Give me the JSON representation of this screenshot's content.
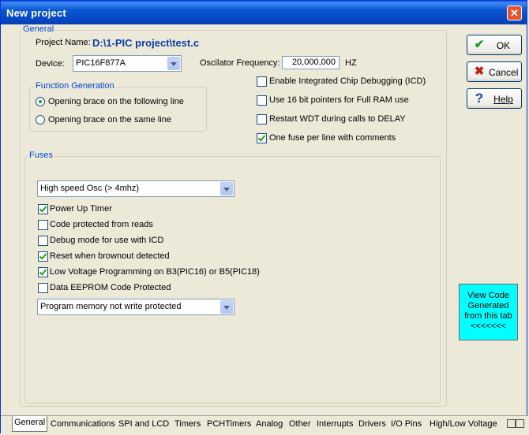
{
  "window": {
    "title": "New project"
  },
  "general": {
    "legend": "General",
    "project_name_label": "Project Name:",
    "project_name": "D:\\1-PIC project\\test.c",
    "device_label": "Device:",
    "device_value": "PIC16F877A",
    "osc_label": "Oscilator Frequency:",
    "osc_value": "20,000,000",
    "osc_unit": "HZ"
  },
  "function_generation": {
    "legend": "Function Generation",
    "options": [
      {
        "label": "Opening brace on the following line",
        "selected": true
      },
      {
        "label": "Opening brace on the same line",
        "selected": false
      }
    ]
  },
  "options": [
    {
      "label": "Enable Integrated Chip Debugging (ICD)",
      "checked": false
    },
    {
      "label": "Use 16 bit pointers for Full RAM use",
      "checked": false
    },
    {
      "label": "Restart WDT during calls to DELAY",
      "checked": false
    },
    {
      "label": "One fuse per line with comments",
      "checked": true
    }
  ],
  "fuses": {
    "legend": "Fuses",
    "oscillator_select": "High speed Osc (> 4mhz)",
    "items": [
      {
        "label": "Power Up Timer",
        "checked": true
      },
      {
        "label": "Code protected from reads",
        "checked": false
      },
      {
        "label": "Debug mode for use with ICD",
        "checked": false
      },
      {
        "label": "Reset when brownout detected",
        "checked": true
      },
      {
        "label": "Low Voltage Programming on B3(PIC16) or B5(PIC18)",
        "checked": true
      },
      {
        "label": "Data EEPROM Code Protected",
        "checked": false
      }
    ],
    "memory_select": "Program memory not write protected"
  },
  "buttons": {
    "ok": "OK",
    "cancel": "Cancel",
    "help": "Help"
  },
  "view_code": {
    "line1": "View Code",
    "line2": "Generated",
    "line3": "from this tab",
    "line4": "<<<<<<<"
  },
  "tabs": [
    "General",
    "Communications",
    "SPI and LCD",
    "Timers",
    "PCHTimers",
    "Analog",
    "Other",
    "Interrupts",
    "Drivers",
    "I/O Pins",
    "High/Low Voltage"
  ],
  "colors": {
    "accent": "#0046d5",
    "titlebar": "#0b57d0",
    "view_code_bg": "#00ffff",
    "check": "#21a121"
  }
}
